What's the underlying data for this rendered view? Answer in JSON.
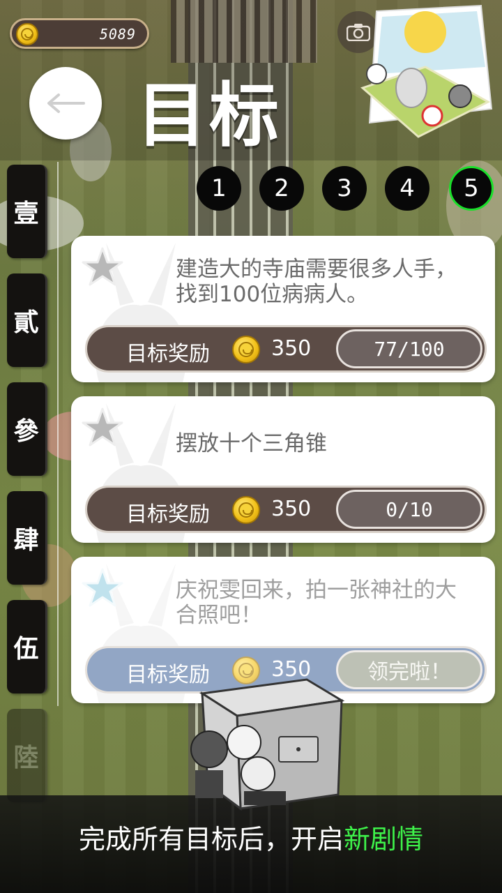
{
  "header": {
    "coins": "5089",
    "title": "目标"
  },
  "chapters": [
    "壹",
    "貳",
    "參",
    "肆",
    "伍",
    "陸"
  ],
  "pages": [
    "1",
    "2",
    "3",
    "4",
    "5"
  ],
  "active_page": "5",
  "goals": [
    {
      "description": "建造大的寺庙需要很多人手，找到100位病病人。",
      "reward_label": "目标奖励",
      "reward_value": "350",
      "progress": "77/100",
      "status": "in-progress"
    },
    {
      "description": "摆放十个三角锥",
      "reward_label": "目标奖励",
      "reward_value": "350",
      "progress": "0/10",
      "status": "in-progress"
    },
    {
      "description": "庆祝雯回来，拍一张神社的大合照吧！",
      "reward_label": "目标奖励",
      "reward_value": "350",
      "progress": "领完啦！",
      "status": "claimed"
    }
  ],
  "footer": {
    "text_prefix": "完成所有目标后，开启",
    "text_highlight": "新剧情"
  },
  "colors": {
    "highlight_green": "#3ef24a",
    "active_ring": "#19e02a",
    "reward_bar": "#5c4c46",
    "claimed_bar": "#5877a6"
  }
}
